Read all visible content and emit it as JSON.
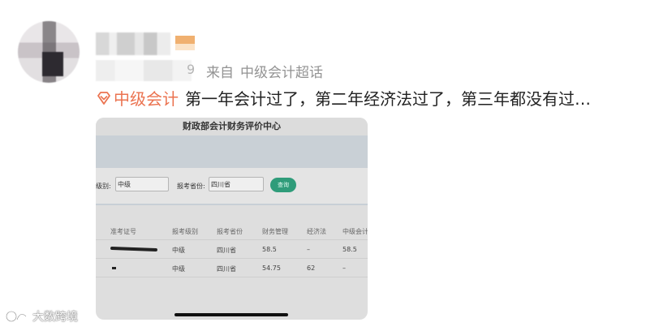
{
  "post": {
    "meta_suffix": "9",
    "meta_from": "来自",
    "meta_source": "中级会计超话",
    "topic": "中级会计",
    "text": "第一年会计过了，第二年经济法过了，第三年都没有过…",
    "topic_color": "#eb7350"
  },
  "screenshot": {
    "title": "财政部会计财务评价中心",
    "filters": {
      "level_label": "级别:",
      "level_value": "中级",
      "province_label": "报考省份:",
      "province_value": "四川省",
      "query_button": "查询",
      "button_color": "#2f9c7a"
    },
    "table": {
      "headers": [
        "准考证号",
        "报考级别",
        "报考省份",
        "财务管理",
        "经济法",
        "中级会计"
      ],
      "rows": [
        {
          "id": "",
          "level": "中级",
          "province": "四川省",
          "finance": "58.5",
          "law": "–",
          "accounting": "58.5"
        },
        {
          "id": "",
          "level": "中级",
          "province": "四川省",
          "finance": "54.75",
          "law": "62",
          "accounting": "–"
        }
      ]
    }
  },
  "watermark": {
    "text": "大数跨境"
  },
  "icons": [
    "topic-diamond-icon",
    "watermark-logo-icon"
  ]
}
